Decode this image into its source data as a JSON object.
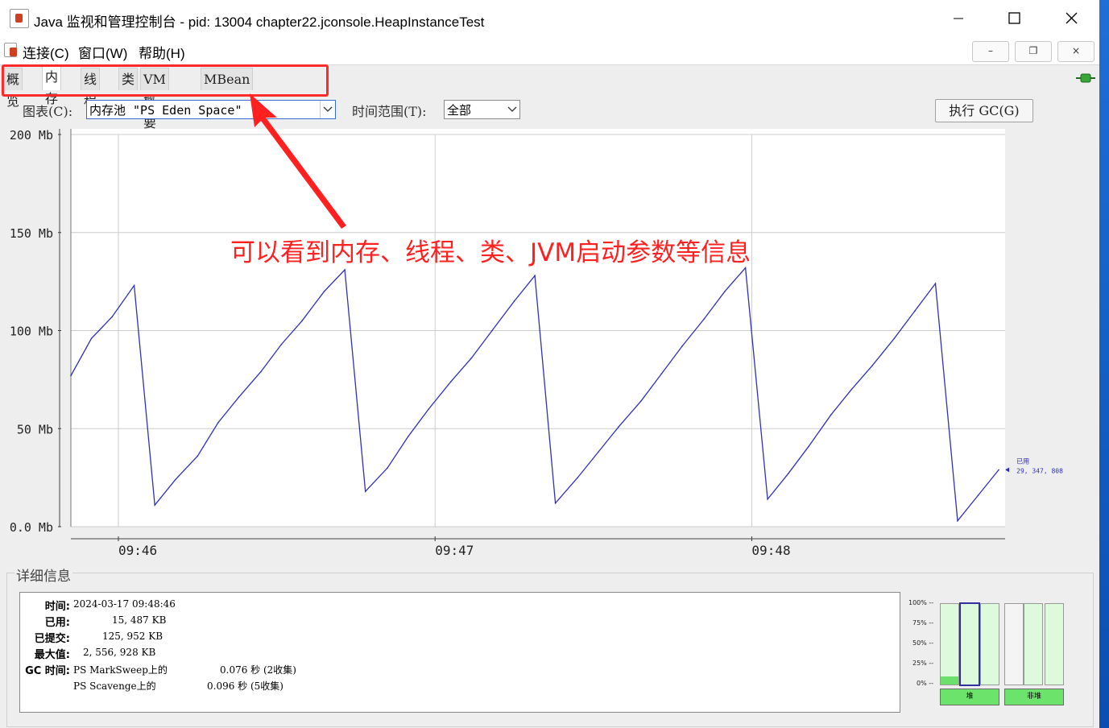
{
  "window": {
    "title": "Java 监视和管理控制台 - pid: 13004 chapter22.jconsole.HeapInstanceTest"
  },
  "menu": {
    "items": [
      "连接(C)",
      "窗口(W)",
      "帮助(H)"
    ],
    "min": "–",
    "restore": "❐",
    "close": "×"
  },
  "tabs": [
    "概览",
    "内存",
    "线程",
    "类",
    "VM 概要",
    "MBean"
  ],
  "toolbar": {
    "chart_label": "图表(C):",
    "chart_value": "内存池 \"PS Eden Space\"",
    "range_label": "时间范围(T):",
    "range_value": "全部",
    "gc_button": "执行 GC(G)"
  },
  "annotation": "可以看到内存、线程、类、JVM启动参数等信息",
  "chart_data": {
    "type": "line",
    "ylim": [
      0,
      200
    ],
    "yticks": [
      "0.0 Mb",
      "50 Mb",
      "100 Mb",
      "150 Mb",
      "200 Mb"
    ],
    "ytick_values": [
      0,
      50,
      100,
      150,
      200
    ],
    "xticks": [
      "09:46",
      "09:47",
      "09:48"
    ],
    "xtick_values": [
      0.3,
      2.3,
      4.3
    ],
    "xlim": [
      0,
      5.9
    ],
    "grid": true,
    "series": [
      {
        "color": "#3030b8",
        "x": [
          0,
          0.13,
          0.26,
          0.4,
          0.53,
          0.66,
          0.8,
          0.93,
          1.06,
          1.2,
          1.33,
          1.46,
          1.6,
          1.73,
          1.86,
          2.0,
          2.13,
          2.26,
          2.4,
          2.53,
          2.66,
          2.8,
          2.93,
          3.06,
          3.2,
          3.33,
          3.46,
          3.6,
          3.73,
          3.86,
          4.0,
          4.13,
          4.26,
          4.4,
          4.53,
          4.66,
          4.8,
          4.93,
          5.06,
          5.2,
          5.33,
          5.46,
          5.6,
          5.73,
          5.86
        ],
        "y": [
          77,
          96,
          107,
          123,
          11,
          24,
          36,
          53,
          66,
          79,
          93,
          105,
          120,
          131,
          18,
          30,
          46,
          60,
          74,
          86,
          100,
          115,
          128,
          12,
          25,
          38,
          51,
          64,
          78,
          92,
          106,
          120,
          132,
          14,
          27,
          41,
          57,
          70,
          82,
          96,
          110,
          124,
          3,
          16,
          29
        ]
      }
    ],
    "end_label": "已用",
    "end_value": "29, 347, 808"
  },
  "details": {
    "title": "详细信息",
    "rows": [
      {
        "key": "时间:",
        "value": "2024-03-17 09:48:46"
      },
      {
        "key": "已用:",
        "value": "15, 487 KB"
      },
      {
        "key": "已提交:",
        "value": "125, 952 KB"
      },
      {
        "key": "最大值:",
        "value": "2, 556, 928 KB"
      },
      {
        "key": "GC 时间:",
        "value": "PS MarkSweep上的"
      }
    ],
    "gc1_time": "0.076 秒 (2收集)",
    "gc2_name": "PS Scavenge上的",
    "gc2_time": "0.096 秒 (5收集)"
  },
  "usage_bars": {
    "ticks": [
      "100% --",
      "75% --",
      "50% --",
      "25% --",
      "0% --"
    ],
    "heap_label": "堆",
    "nonheap_label": "非堆",
    "heap_levels": [
      0.1,
      0.0,
      0.0
    ],
    "nonheap_levels": [
      0.0,
      0.0,
      0.0
    ]
  }
}
